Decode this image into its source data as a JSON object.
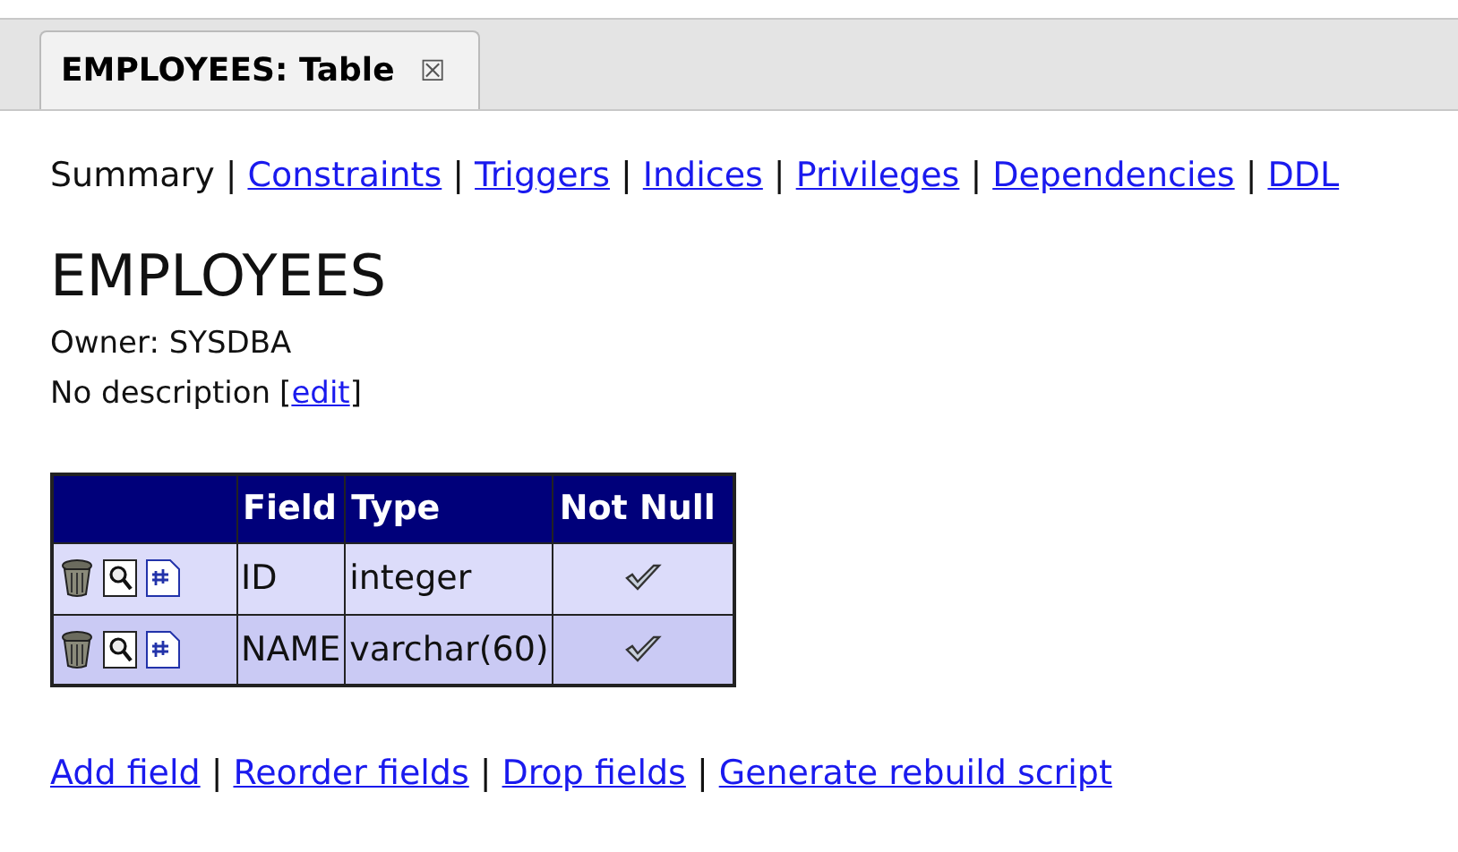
{
  "tab": {
    "title": "EMPLOYEES: Table",
    "close": "☒"
  },
  "nav": [
    {
      "label": "Summary",
      "selected": true
    },
    {
      "label": "Constraints",
      "selected": false
    },
    {
      "label": "Triggers",
      "selected": false
    },
    {
      "label": "Indices",
      "selected": false
    },
    {
      "label": "Privileges",
      "selected": false
    },
    {
      "label": "Dependencies",
      "selected": false
    },
    {
      "label": "DDL",
      "selected": false
    }
  ],
  "nav_separator": "|",
  "heading": "EMPLOYEES",
  "owner": "Owner: SYSDBA",
  "description": {
    "text": "No description",
    "open_bracket": "[",
    "link": "edit",
    "close_bracket": "]"
  },
  "table": {
    "columns": [
      "Field",
      "Type",
      "Not Null"
    ],
    "rows": [
      {
        "field": "ID",
        "type": "integer",
        "not_null": true
      },
      {
        "field": "NAME",
        "type": "varchar(60)",
        "not_null": true
      }
    ]
  },
  "actions": [
    "Add field",
    "Reorder fields",
    "Drop fields",
    "Generate rebuild script"
  ],
  "action_separator": "|"
}
